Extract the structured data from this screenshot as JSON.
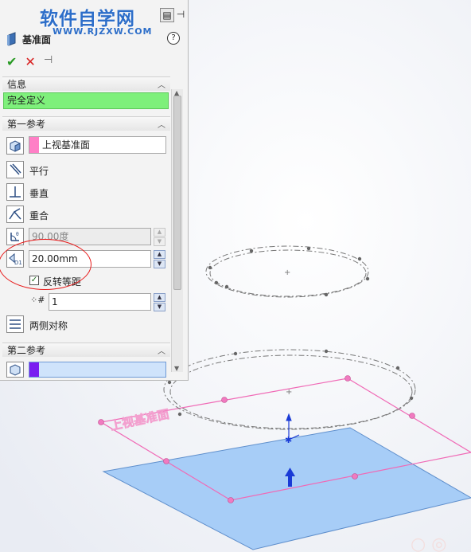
{
  "watermark": {
    "title": "软件自学网",
    "url": "WWW.RJZXW.COM"
  },
  "panel": {
    "title": "基准面",
    "help_label": "?",
    "actions": {
      "ok": "✔",
      "cancel": "✕",
      "pin": "⊣"
    },
    "info": {
      "header": "信息",
      "status": "完全定义"
    },
    "first_ref": {
      "header": "第一参考",
      "reference": "上视基准面",
      "reference_color": "#ff7fc6",
      "options": [
        "平行",
        "垂直",
        "重合"
      ],
      "angle_value": "90.00度",
      "distance_value": "20.00mm",
      "flip_label": "反转等距",
      "flip_checked": true,
      "count_value": "1",
      "symmetric_label": "两侧对称"
    },
    "second_ref": {
      "header": "第二参考",
      "reference_color": "#7a1cf0"
    }
  },
  "viewport": {
    "plane_label": "上视基准面",
    "plane_color": "#a7cdf7",
    "preview_color": "#f06ab6"
  }
}
